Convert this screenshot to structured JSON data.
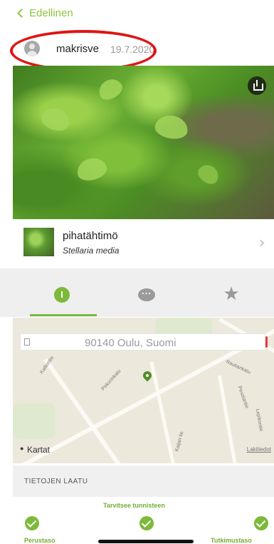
{
  "nav": {
    "back_label": "Edellinen"
  },
  "observation": {
    "username": "makrisve",
    "date": "19.7.2020"
  },
  "species": {
    "common_name": "pihatähtimö",
    "scientific_name": "Stellaria media"
  },
  "map": {
    "address": "90140 Oulu, Suomi",
    "attribution": "Kartat",
    "legal": "Lakitiedot",
    "streets": [
      "Kalliontie",
      "Pekurinkatu",
      "Rautiankatu",
      "Pesolantie",
      "Kaijan tie",
      "Lepikontie"
    ]
  },
  "quality": {
    "section_title": "TIETOJEN LAATU",
    "middle_label": "Tarvitsee tunnisteen",
    "left_label": "Perustaso",
    "right_label": "Tutkimustaso"
  },
  "colors": {
    "accent": "#7db93a",
    "annotation_ring": "#e01414"
  },
  "icons": [
    "back-chevron-icon",
    "user-avatar-icon",
    "share-icon",
    "info-icon",
    "comment-icon",
    "star-icon",
    "location-icon",
    "map-pin-icon",
    "check-icon",
    "chevron-right-icon"
  ]
}
